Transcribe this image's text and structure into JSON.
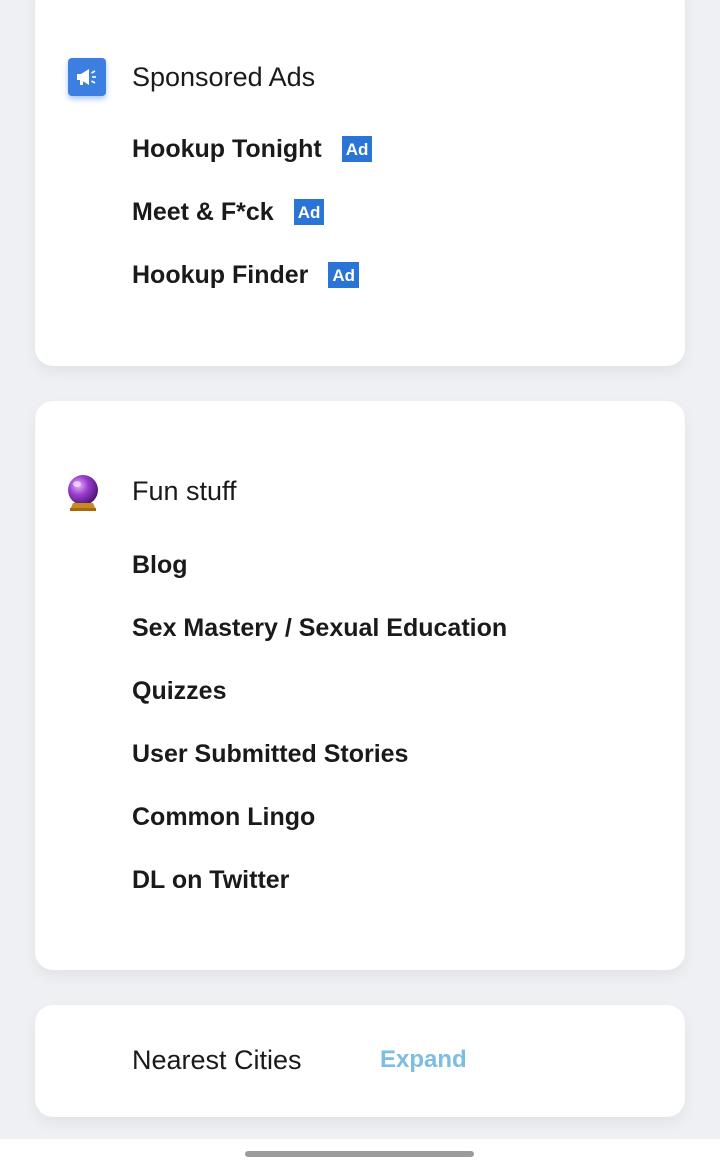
{
  "sponsored": {
    "title": "Sponsored Ads",
    "icon": "megaphone-icon",
    "items": [
      {
        "label": "Hookup Tonight",
        "badge": "Ad"
      },
      {
        "label": "Meet & F*ck",
        "badge": "Ad"
      },
      {
        "label": "Hookup Finder",
        "badge": "Ad"
      }
    ]
  },
  "fun": {
    "title": "Fun stuff",
    "icon": "crystal-ball-icon",
    "items": [
      {
        "label": "Blog"
      },
      {
        "label": "Sex Mastery / Sexual Education"
      },
      {
        "label": "Quizzes"
      },
      {
        "label": "User Submitted Stories"
      },
      {
        "label": "Common Lingo"
      },
      {
        "label": "DL on Twitter"
      }
    ]
  },
  "cities": {
    "title": "Nearest Cities",
    "expand_label": "Expand"
  },
  "colors": {
    "ad_badge": "#2a74d6",
    "expand_link": "#7cbde2",
    "megaphone_bg": "#3d7fe0"
  }
}
